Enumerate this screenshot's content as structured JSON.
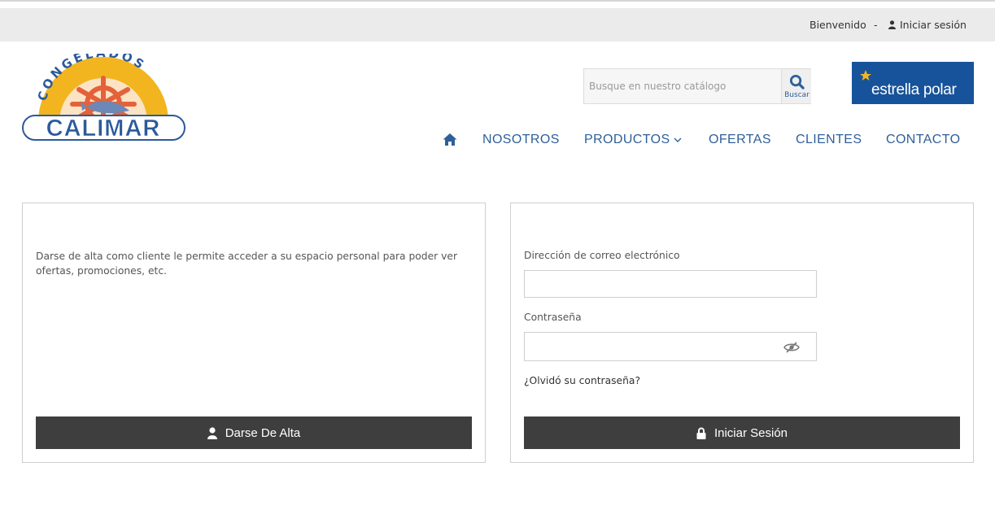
{
  "topbar": {
    "welcome": "Bienvenido",
    "separator": "-",
    "login_link": "Iniciar sesión"
  },
  "logo": {
    "arc_text": "CONGELADOS",
    "name": "CALIMAR"
  },
  "search": {
    "placeholder": "Busque en nuestro catálogo",
    "button_label": "Buscar"
  },
  "brand_banner": {
    "text": "estrella polar"
  },
  "nav": {
    "home_icon": "home-icon",
    "items": [
      "NOSOTROS",
      "PRODUCTOS",
      "OFERTAS",
      "CLIENTES",
      "CONTACTO"
    ]
  },
  "register_panel": {
    "description": "Darse de alta como cliente le permite acceder a su espacio personal para poder ver ofertas, promociones, etc.",
    "button_label": "Darse De Alta",
    "button_icon": "user-icon"
  },
  "login_panel": {
    "email_label": "Dirección de correo electrónico",
    "email_value": "",
    "password_label": "Contraseña",
    "password_value": "",
    "password_toggle_icon": "eye-slash-icon",
    "forgot_link": "¿Olvidó su contraseña?",
    "button_label": "Iniciar Sesión",
    "button_icon": "lock-icon"
  },
  "colors": {
    "nav_blue": "#2f5f99",
    "brand_blue": "#17539a",
    "button_dark": "#3e3e3e",
    "topbar_bg": "#ebebeb"
  }
}
